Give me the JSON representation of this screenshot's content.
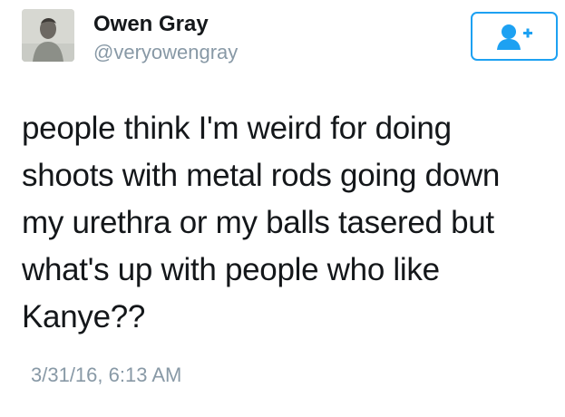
{
  "tweet": {
    "author": {
      "display_name": "Owen Gray",
      "handle": "@veryowengray",
      "avatar_icon": "user-photo-avatar"
    },
    "follow_button": {
      "icon": "add-user-icon"
    },
    "text": "people think I'm weird for doing\nshoots with metal rods going down\nmy urethra or my balls tasered but\nwhat's up with people who like\nKanye??",
    "timestamp": "3/31/16, 6:13 AM"
  },
  "colors": {
    "accent": "#1da1f2",
    "text": "#14171a",
    "secondary_text": "#8899a6",
    "background": "#ffffff"
  }
}
